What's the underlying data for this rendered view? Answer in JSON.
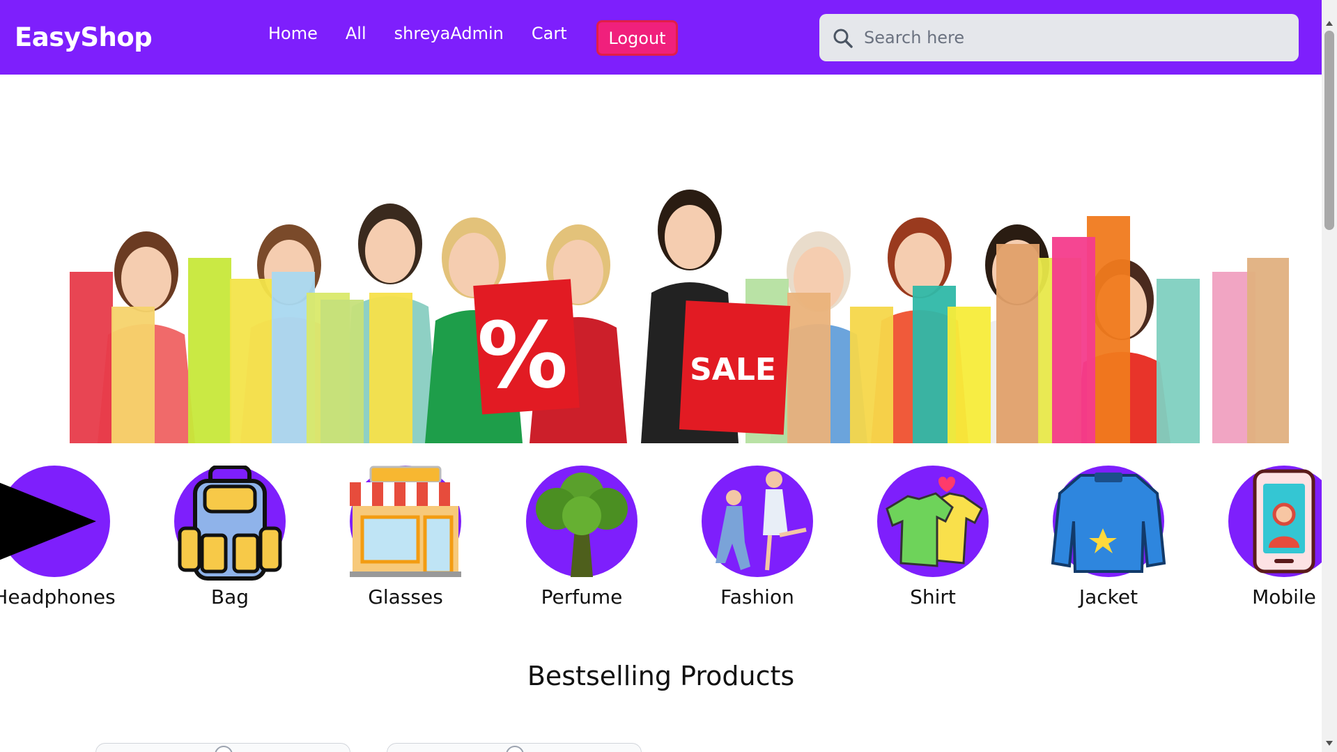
{
  "navbar": {
    "brand": "EasyShop",
    "links": [
      "Home",
      "All",
      "shreyaAdmin",
      "Cart"
    ],
    "logout_label": "Logout",
    "accent_color": "#7e1ffc",
    "logout_color": "#f0207c"
  },
  "search": {
    "placeholder": "Search here",
    "value": ""
  },
  "hero": {
    "sign_percent": "%",
    "sign_sale": "SALE"
  },
  "categories": [
    {
      "label": "Headphones",
      "icon": "play-icon"
    },
    {
      "label": "Bag",
      "icon": "backpack-icon"
    },
    {
      "label": "Glasses",
      "icon": "store-icon"
    },
    {
      "label": "Perfume",
      "icon": "tree-icon"
    },
    {
      "label": "Fashion",
      "icon": "couple-icon"
    },
    {
      "label": "Shirt",
      "icon": "tshirt-icon"
    },
    {
      "label": "Jacket",
      "icon": "jacket-icon"
    },
    {
      "label": "Mobile",
      "icon": "mobile-icon"
    }
  ],
  "bestselling": {
    "title": "Bestselling Products"
  }
}
